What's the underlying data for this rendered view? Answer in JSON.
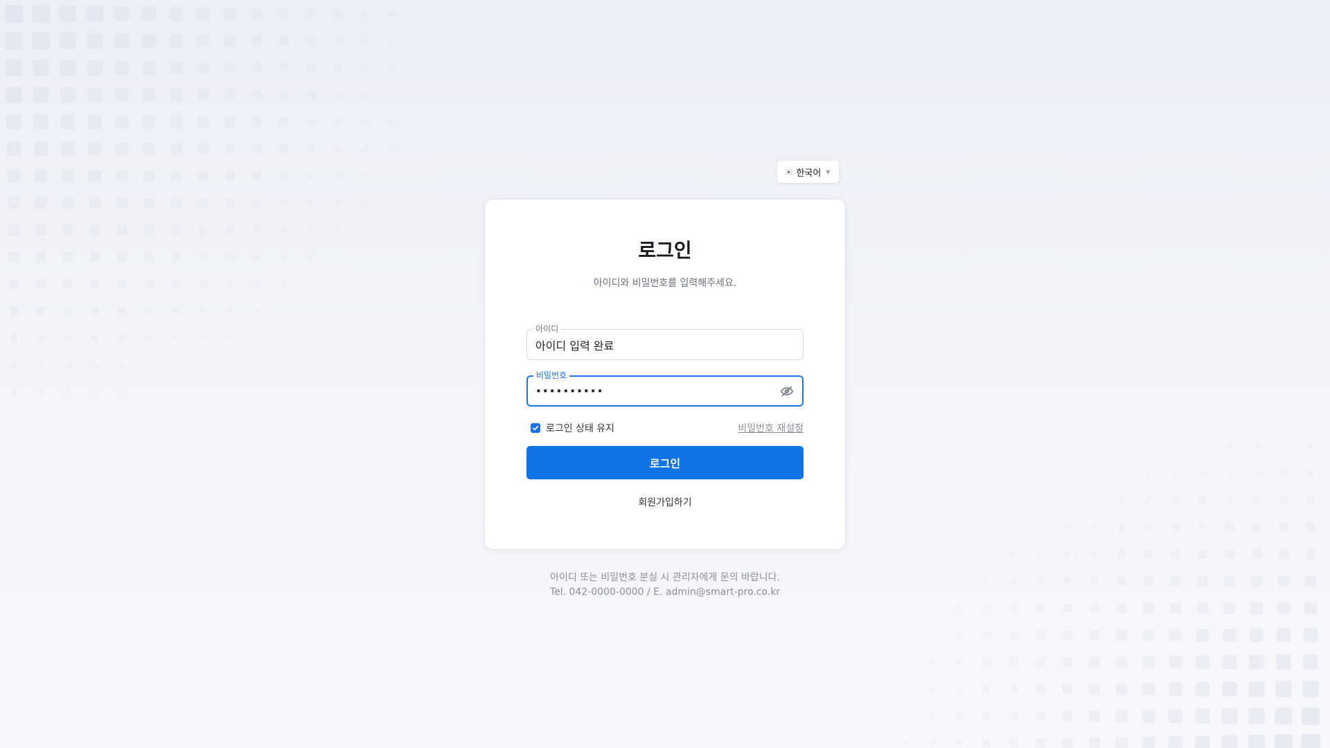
{
  "language_selector": {
    "label": "한국어",
    "flag_icon": "korea-flag-icon",
    "chevron_icon": "chevron-down-icon"
  },
  "login_card": {
    "title": "로그인",
    "subtitle": "아이디와 비밀번호를 입력해주세요.",
    "id_field": {
      "label": "아이디",
      "value": "아이디 입력 완료"
    },
    "password_field": {
      "label": "비밀번호",
      "value": "••••••••••",
      "toggle_icon": "eye-slash-icon"
    },
    "remember_me": {
      "label": "로그인 상태 유지",
      "checked": true
    },
    "reset_password_label": "비밀번호 재설정",
    "login_button_label": "로그인",
    "signup_label": "회원가입하기"
  },
  "footer": {
    "line1": "아이디 또는 비밀번호 분실 시 관리자에게 문의 바랍니다.",
    "line2": "Tel. 042-0000-0000 / E. admin@smart-pro.co.kr"
  },
  "colors": {
    "accent": "#1174e6",
    "focus_border": "#1a73e8",
    "background": "#eceff6"
  }
}
